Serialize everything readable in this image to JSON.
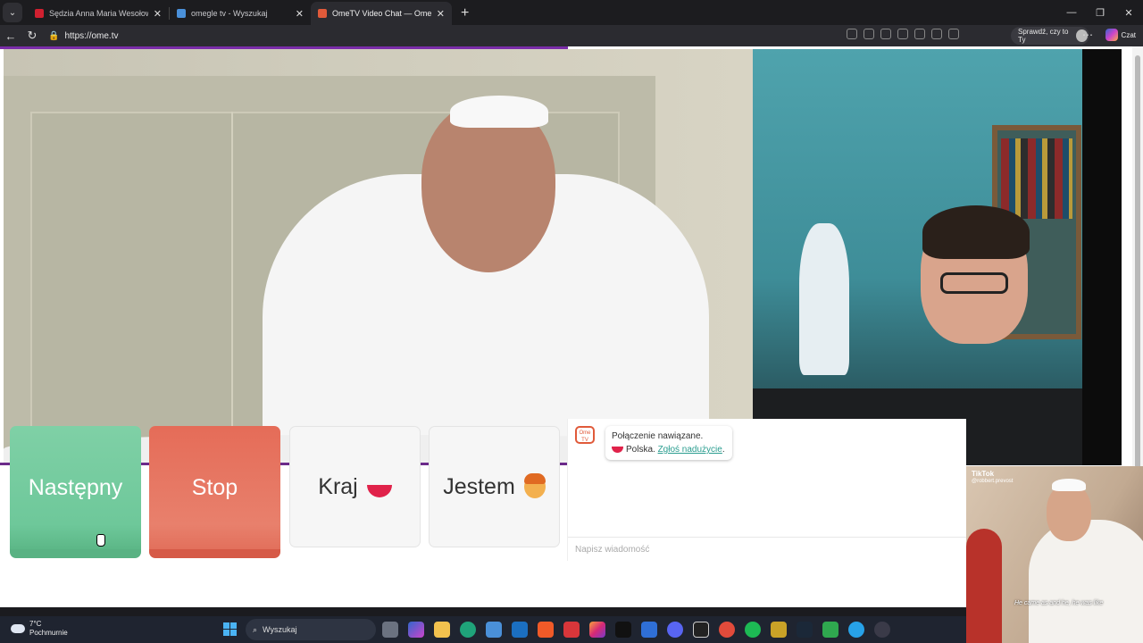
{
  "browser": {
    "tabs": [
      {
        "title": "Sędzia Anna Maria Wesołowska o",
        "active": false,
        "favicon_color": "#d02030"
      },
      {
        "title": "omegle tv - Wyszukaj",
        "active": false,
        "favicon_color": "#4a90d9"
      },
      {
        "title": "OmeTV Video Chat — Omegle",
        "active": true,
        "favicon_color": "#e05a3a"
      }
    ],
    "new_tab": "+",
    "address": "https://ome.tv",
    "profile_label": "Sprawdź, czy to Ty",
    "copilot_label": "Czat"
  },
  "controls": {
    "next_label": "Następny",
    "stop_label": "Stop",
    "country_label": "Kraj",
    "gender_label": "Jestem"
  },
  "chat": {
    "badge": "Ome TV",
    "status_line": "Połączenie nawiązane.",
    "country": "Polska.",
    "report_link": "Zgłoś nadużycie",
    "report_suffix": ".",
    "input_placeholder": "Napisz wiadomość"
  },
  "overlay": {
    "brand": "TikTok",
    "handle": "@robbert.prevost",
    "caption": "He came as and he, he was like"
  },
  "taskbar": {
    "temperature": "7°C",
    "condition": "Pochmurnie",
    "search_label": "Wyszukaj",
    "apps": [
      "file-explorer",
      "copilot",
      "folder",
      "edge",
      "store",
      "outlook",
      "brave",
      "office",
      "instagram",
      "tiktok",
      "calendar",
      "discord",
      "ubisoft",
      "game-app",
      "spotify",
      "journal",
      "steam",
      "xbox",
      "messenger",
      "obs"
    ]
  },
  "colors": {
    "next": "#6ec89a",
    "stop": "#e8806c",
    "accent": "#7a2ca8",
    "link": "#2a9d8f"
  }
}
